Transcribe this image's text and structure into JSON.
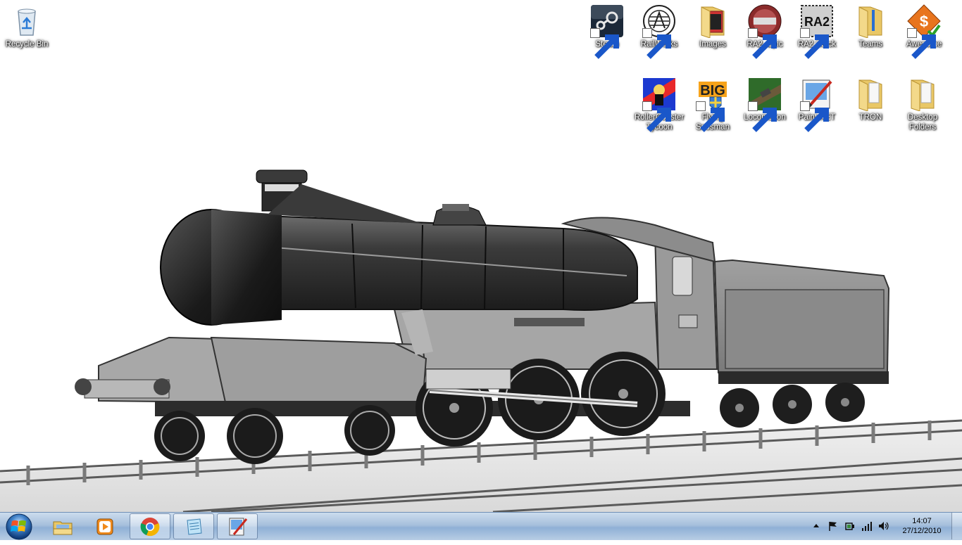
{
  "desktop": {
    "icons": [
      {
        "label": "Recycle Bin"
      },
      {
        "label": "Steam"
      },
      {
        "label": "RailWorks"
      },
      {
        "label": "Images"
      },
      {
        "label": "RA2, Epic"
      },
      {
        "label": "RA2 Stock"
      },
      {
        "label": "Teams"
      },
      {
        "label": "Awesome"
      },
      {
        "label": "RollerCoaster Tycoon"
      },
      {
        "label": "Flying Scosman"
      },
      {
        "label": "Locomotion"
      },
      {
        "label": "Paint.NET"
      },
      {
        "label": "TRON"
      },
      {
        "label": "Desktop Folders"
      }
    ],
    "tile_text": {
      "ra2": "RA2",
      "big": "BIG",
      "dollar": "$"
    }
  },
  "taskbar": {
    "pinned": [
      "windows-explorer-icon",
      "windows-media-player-icon",
      "chrome-icon",
      "notepad-icon",
      "paint-net-icon"
    ],
    "clock": {
      "time": "14:07",
      "date": "27/12/2010"
    }
  }
}
